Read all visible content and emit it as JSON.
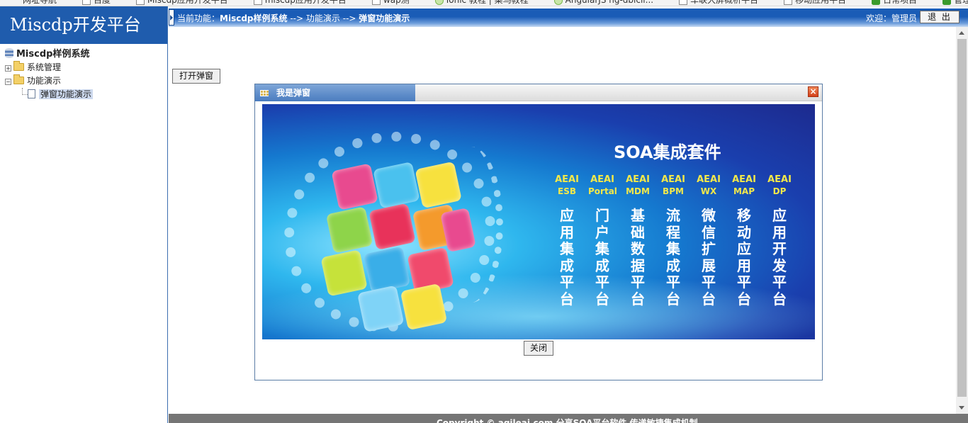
{
  "browser": {
    "bookmarks": [
      {
        "label": "网址导航",
        "icon": "hao123-icon"
      },
      {
        "label": "百度",
        "icon": "baidu-icon"
      },
      {
        "label": "Miscdp应用开发平台",
        "icon": "page-icon"
      },
      {
        "label": "miscdp应用开发平台",
        "icon": "page-icon"
      },
      {
        "label": "wap测",
        "icon": "page-icon"
      },
      {
        "label": "Ionic 教程 | 菜鸟教程",
        "icon": "globe-icon"
      },
      {
        "label": "AngularJS ng-dblcli...",
        "icon": "globe-icon"
      },
      {
        "label": "车联大屏概析平台",
        "icon": "page-icon"
      },
      {
        "label": "移动应用平台",
        "icon": "page-icon"
      },
      {
        "label": "日常项目",
        "icon": "leaf-icon"
      },
      {
        "label": "管理控制台",
        "icon": "leaf-icon"
      }
    ]
  },
  "sidebar": {
    "brand": "Miscdp开发平台",
    "tree": {
      "root": "Miscdp样例系统",
      "nodes": [
        {
          "label": "系统管理",
          "expander": "+"
        },
        {
          "label": "功能演示",
          "expander": "−"
        }
      ],
      "child": "弹窗功能演示"
    }
  },
  "header": {
    "current_prefix": "当前功能：",
    "crumb1": "Miscdp样例系统",
    "arrow": "-->",
    "crumb2": "功能演示",
    "crumb3": "弹窗功能演示",
    "welcome": "欢迎：管理员",
    "logout": "退 出"
  },
  "main": {
    "open_button": "打开弹窗"
  },
  "dialog": {
    "title": "我是弹窗",
    "close_icon": "×",
    "close_button": "关闭",
    "banner": {
      "title": "SOA集成套件",
      "products": [
        {
          "code": "AEAI",
          "sub": "ESB",
          "name": "应用集成平台"
        },
        {
          "code": "AEAI",
          "sub": "Portal",
          "name": "门户集成平台"
        },
        {
          "code": "AEAI",
          "sub": "MDM",
          "name": "基础数据平台"
        },
        {
          "code": "AEAI",
          "sub": "BPM",
          "name": "流程集成平台"
        },
        {
          "code": "AEAI",
          "sub": "WX",
          "name": "微信扩展平台"
        },
        {
          "code": "AEAI",
          "sub": "MAP",
          "name": "移动应用平台"
        },
        {
          "code": "AEAI",
          "sub": "DP",
          "name": "应用开发平台"
        }
      ]
    }
  },
  "footer": {
    "text": "Copyright © agileai.com     分享SOA平台软件  传递敏捷集成机制"
  },
  "colors": {
    "brand_blue": "#1f5cad",
    "header_blue": "#1a5cb6",
    "dialog_border": "#5b7da6",
    "banner_text_yellow": "#f2e84a"
  }
}
